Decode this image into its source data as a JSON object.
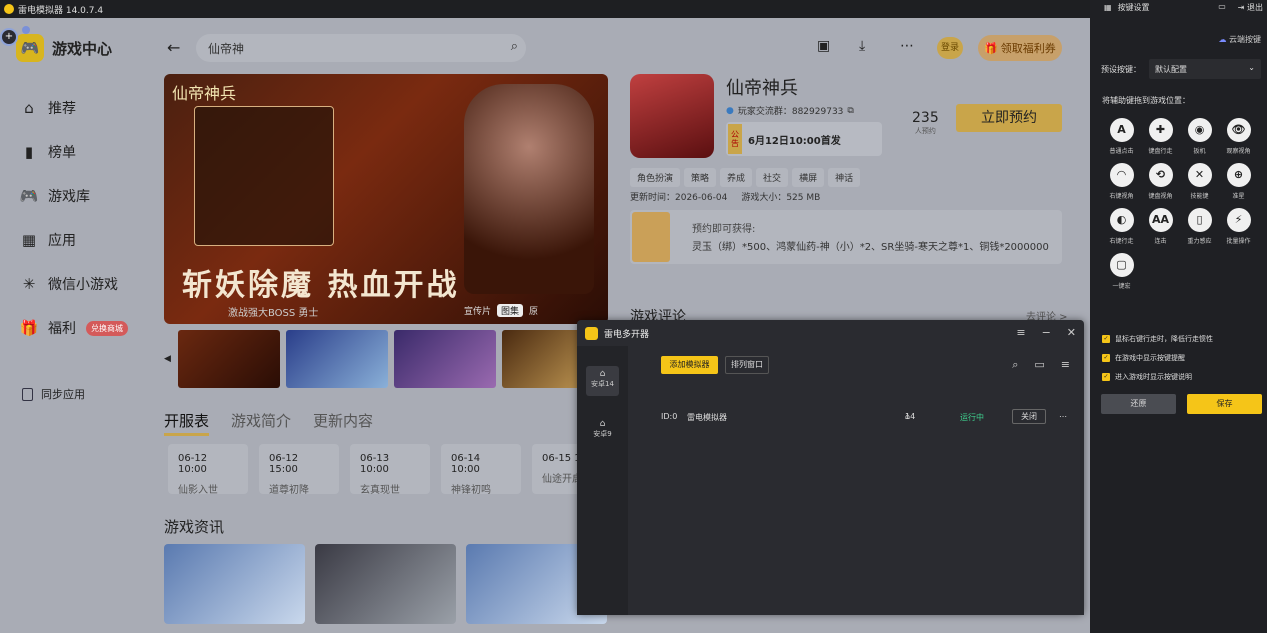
{
  "window": {
    "title": "雷电模拟器 14.0.7.4"
  },
  "sidebar": {
    "brand": "游戏中心",
    "items": [
      {
        "label": "推荐",
        "icon": "home-icon"
      },
      {
        "label": "榜单",
        "icon": "chart-icon"
      },
      {
        "label": "游戏库",
        "icon": "gamepad-icon"
      },
      {
        "label": "应用",
        "icon": "apps-icon"
      },
      {
        "label": "微信小游戏",
        "icon": "wechat-game-icon"
      },
      {
        "label": "福利",
        "icon": "gift-icon",
        "badge": "兑换商城"
      }
    ],
    "sync": "同步应用"
  },
  "topbar": {
    "search_value": "仙帝神",
    "login": "登录",
    "coupon": "领取福利券"
  },
  "banner": {
    "logo_text": "仙帝神兵",
    "slogan": "斩妖除魔 热血开战",
    "sub": "激战强大BOSS 勇士",
    "tabs": [
      "宣传片",
      "图集",
      "原"
    ],
    "active_tab": 1
  },
  "section_tabs": {
    "items": [
      "开服表",
      "游戏简介",
      "更新内容"
    ],
    "active": 0
  },
  "servers": [
    {
      "time": "06-12 10:00",
      "name": "仙影入世"
    },
    {
      "time": "06-12 15:00",
      "name": "道尊初降"
    },
    {
      "time": "06-13 10:00",
      "name": "玄真现世"
    },
    {
      "time": "06-14 10:00",
      "name": "神锋初鸣"
    },
    {
      "time": "06-15 1",
      "name": "仙途开启"
    }
  ],
  "news": {
    "title": "游戏资讯"
  },
  "game": {
    "title": "仙帝神兵",
    "community": "玩家交流群：882929733",
    "notice_tag": "公告",
    "notice": "6月12日10:00首发",
    "reserve_count": "235",
    "reserve_count_label": "人预约",
    "reserve_button": "立即预约",
    "tags": [
      "角色扮演",
      "策略",
      "养成",
      "社交",
      "横屏",
      "神话"
    ],
    "updated": "更新时间：2026-06-04",
    "size": "游戏大小：525 MB",
    "reward_title": "预约即可获得:",
    "reward_detail": "灵玉（绑）*500、鸿蒙仙药-神（小）*2、SR坐骑-寒天之尊*1、铜钱*2000000",
    "comments_title": "游戏评论",
    "comments_link": "去评论 >"
  },
  "multi": {
    "title": "雷电多开器",
    "add": "添加模拟器",
    "arrange": "排列窗口",
    "tabs": [
      {
        "label": "安卓14"
      },
      {
        "label": "安卓9"
      }
    ],
    "row": {
      "id": "ID:0",
      "name": "雷电模拟器",
      "version": "14",
      "status": "运行中",
      "close": "关闭"
    }
  },
  "keypanel": {
    "title": "按键设置",
    "exit": "退出",
    "cloud": "云端按键",
    "preset_label": "预设按键：",
    "preset_value": "默认配置",
    "hint": "将辅助键拖到游戏位置：",
    "keys": [
      {
        "glyph": "A",
        "label": "普通点击"
      },
      {
        "glyph": "✚",
        "label": "键盘行走"
      },
      {
        "glyph": "◉",
        "label": "扳机"
      },
      {
        "glyph": "👁",
        "label": "观察视角"
      },
      {
        "glyph": "◠",
        "label": "右键视角"
      },
      {
        "glyph": "⟲",
        "label": "键盘视角"
      },
      {
        "glyph": "✕",
        "label": "技能键"
      },
      {
        "glyph": "⊕",
        "label": "准星"
      },
      {
        "glyph": "◐",
        "label": "右键行走"
      },
      {
        "glyph": "AA",
        "label": "连击"
      },
      {
        "glyph": "▯",
        "label": "重力感应"
      },
      {
        "glyph": "⚡",
        "label": "批量操作"
      },
      {
        "glyph": "▢",
        "label": "一键宏"
      }
    ],
    "checks": [
      "鼠标右键行走时，降低行走惯性",
      "在游戏中显示按键提醒",
      "进入游戏时显示按键说明"
    ],
    "reset": "还原",
    "save": "保存"
  },
  "colors": {
    "accent": "#f5c518",
    "dark_panel": "#1f2024",
    "overlay": "#a9acb5"
  }
}
